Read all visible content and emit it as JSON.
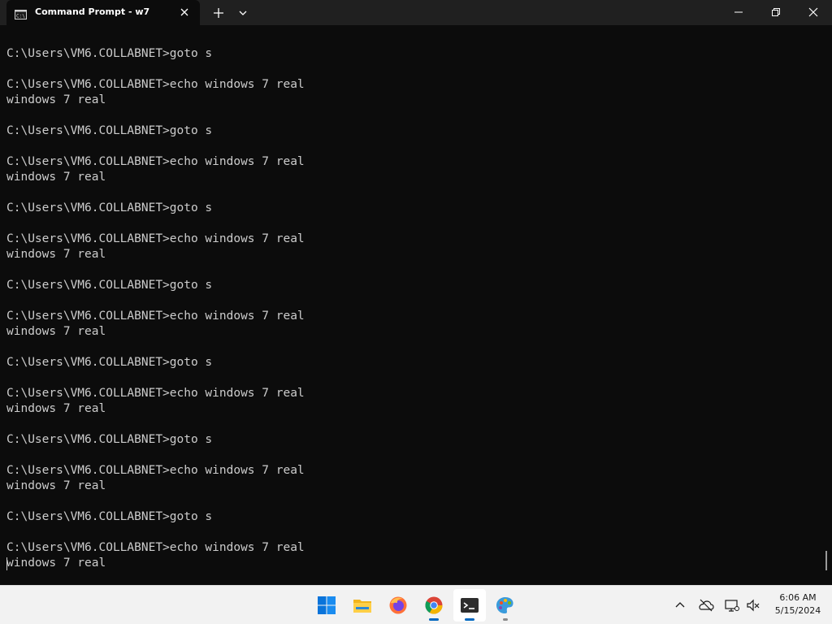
{
  "window": {
    "tab_title": "Command Prompt - w7",
    "tab_icon": "cmd-icon",
    "new_tab_icon": "plus-icon",
    "dropdown_icon": "chevron-down-icon",
    "controls": [
      "minimize-icon",
      "maximize-icon",
      "close-icon"
    ]
  },
  "console": {
    "lines": [
      "C:\\Users\\VM6.COLLABNET>goto s",
      "",
      "C:\\Users\\VM6.COLLABNET>echo windows 7 real",
      "windows 7 real",
      "",
      "C:\\Users\\VM6.COLLABNET>goto s",
      "",
      "C:\\Users\\VM6.COLLABNET>echo windows 7 real",
      "windows 7 real",
      "",
      "C:\\Users\\VM6.COLLABNET>goto s",
      "",
      "C:\\Users\\VM6.COLLABNET>echo windows 7 real",
      "windows 7 real",
      "",
      "C:\\Users\\VM6.COLLABNET>goto s",
      "",
      "C:\\Users\\VM6.COLLABNET>echo windows 7 real",
      "windows 7 real",
      "",
      "C:\\Users\\VM6.COLLABNET>goto s",
      "",
      "C:\\Users\\VM6.COLLABNET>echo windows 7 real",
      "windows 7 real",
      "",
      "C:\\Users\\VM6.COLLABNET>goto s",
      "",
      "C:\\Users\\VM6.COLLABNET>echo windows 7 real",
      "windows 7 real",
      "",
      "C:\\Users\\VM6.COLLABNET>goto s",
      "",
      "C:\\Users\\VM6.COLLABNET>echo windows 7 real",
      "windows 7 real"
    ]
  },
  "taskbar": {
    "apps": [
      "windows-start-icon",
      "file-explorer-icon",
      "firefox-icon",
      "chrome-icon",
      "terminal-icon",
      "paint-icon"
    ],
    "tray": [
      "chevron-up-icon",
      "onedrive-icon",
      "network-icon",
      "volume-muted-icon"
    ],
    "time": "6:06 AM",
    "date": "5/15/2024"
  },
  "colors": {
    "console_bg": "#0c0c0c",
    "console_fg": "#cccccc",
    "titlebar_bg": "#202020",
    "taskbar_bg": "#f2f2f2",
    "accent": "#0067c0"
  }
}
